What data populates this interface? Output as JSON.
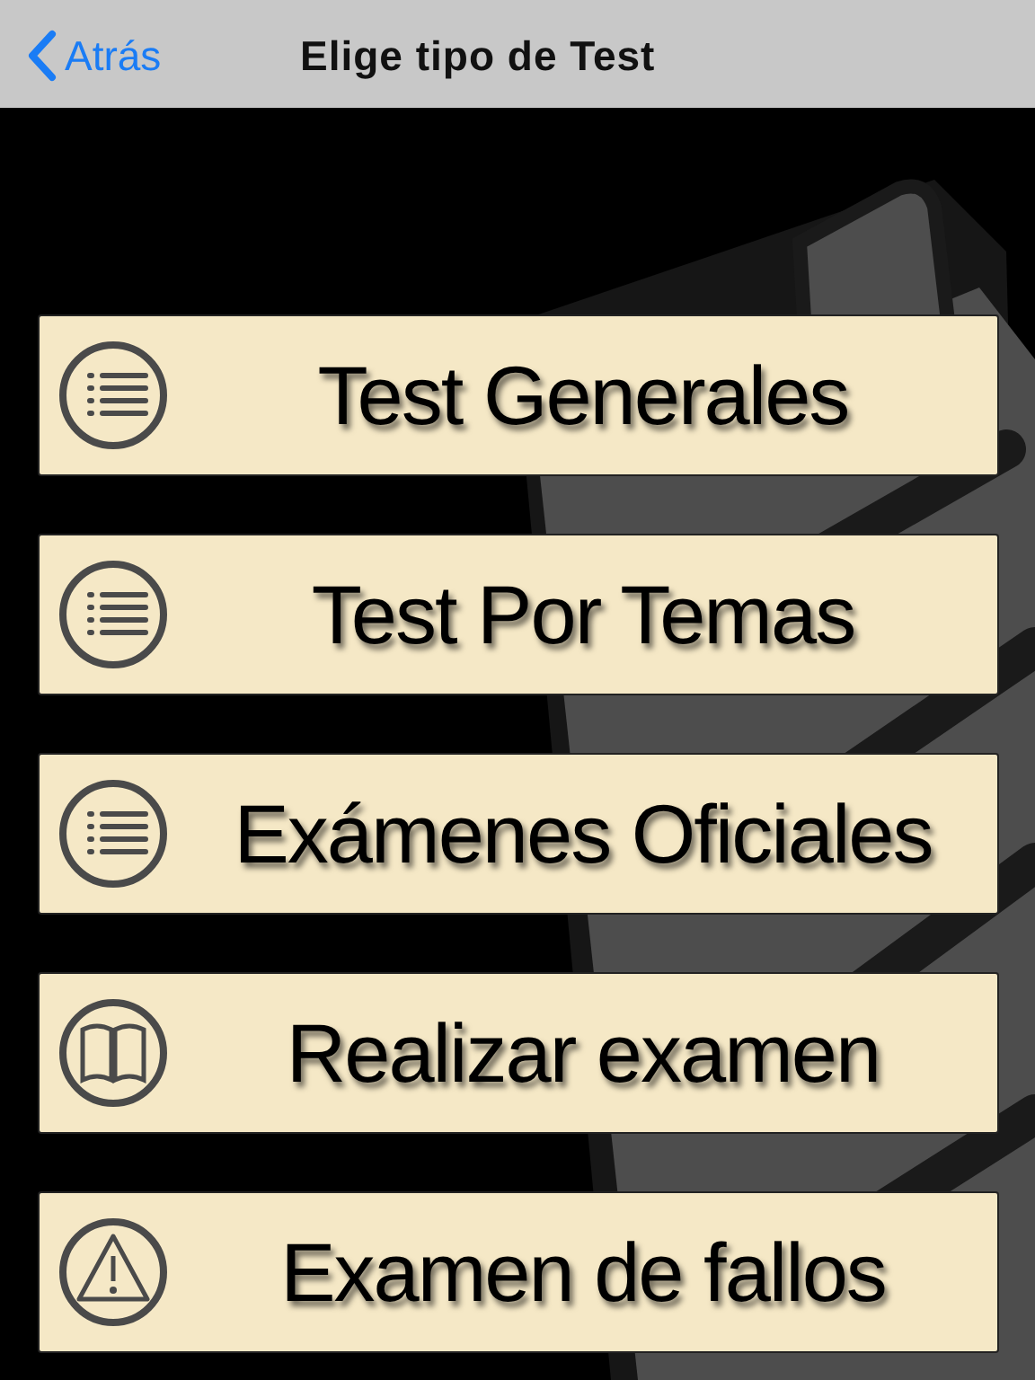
{
  "navbar": {
    "back": "Atrás",
    "title": "Elige tipo de Test"
  },
  "options": [
    {
      "label": "Test Generales",
      "kind": "list"
    },
    {
      "label": "Test Por Temas",
      "kind": "list"
    },
    {
      "label": "Exámenes Oficiales",
      "kind": "list"
    },
    {
      "label": "Realizar examen",
      "kind": "book"
    },
    {
      "label": "Examen de fallos",
      "kind": "warning"
    }
  ]
}
